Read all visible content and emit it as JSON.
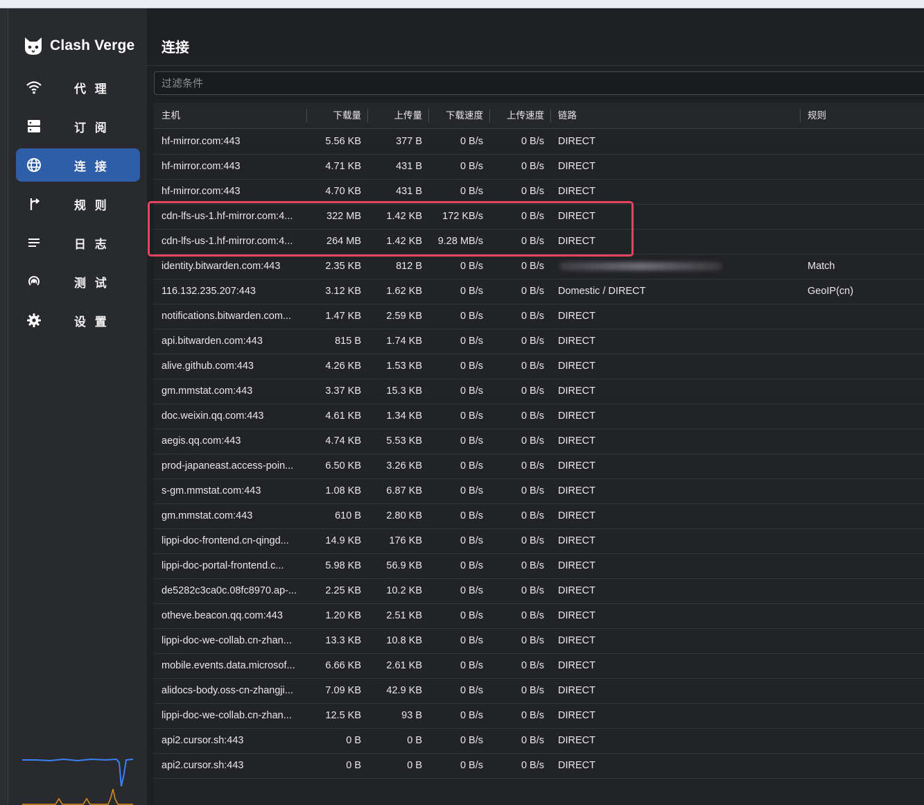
{
  "app": {
    "name": "Clash Verge"
  },
  "sidebar": {
    "items": [
      {
        "label": "代 理",
        "icon": "wifi-icon",
        "active": false
      },
      {
        "label": "订 阅",
        "icon": "server-icon",
        "active": false
      },
      {
        "label": "连 接",
        "icon": "globe-icon",
        "active": true
      },
      {
        "label": "规 则",
        "icon": "fork-icon",
        "active": false
      },
      {
        "label": "日 志",
        "icon": "list-icon",
        "active": false
      },
      {
        "label": "测 试",
        "icon": "radar-icon",
        "active": false
      },
      {
        "label": "设 置",
        "icon": "gear-icon",
        "active": false
      }
    ]
  },
  "page": {
    "title": "连接"
  },
  "filter": {
    "placeholder": "过滤条件",
    "value": ""
  },
  "table": {
    "headers": {
      "host": "主机",
      "download": "下载量",
      "upload": "上传量",
      "dl_speed": "下载速度",
      "ul_speed": "上传速度",
      "chain": "链路",
      "rule": "规则"
    },
    "rows": [
      {
        "host": "hf-mirror.com:443",
        "download": "5.56 KB",
        "upload": "377 B",
        "dl_speed": "0 B/s",
        "ul_speed": "0 B/s",
        "chain": "DIRECT",
        "rule": ""
      },
      {
        "host": "hf-mirror.com:443",
        "download": "4.71 KB",
        "upload": "431 B",
        "dl_speed": "0 B/s",
        "ul_speed": "0 B/s",
        "chain": "DIRECT",
        "rule": ""
      },
      {
        "host": "hf-mirror.com:443",
        "download": "4.70 KB",
        "upload": "431 B",
        "dl_speed": "0 B/s",
        "ul_speed": "0 B/s",
        "chain": "DIRECT",
        "rule": ""
      },
      {
        "host": "cdn-lfs-us-1.hf-mirror.com:4...",
        "download": "322 MB",
        "upload": "1.42 KB",
        "dl_speed": "172 KB/s",
        "ul_speed": "0 B/s",
        "chain": "DIRECT",
        "rule": ""
      },
      {
        "host": "cdn-lfs-us-1.hf-mirror.com:4...",
        "download": "264 MB",
        "upload": "1.42 KB",
        "dl_speed": "9.28 MB/s",
        "ul_speed": "0 B/s",
        "chain": "DIRECT",
        "rule": ""
      },
      {
        "host": "identity.bitwarden.com:443",
        "download": "2.35 KB",
        "upload": "812 B",
        "dl_speed": "0 B/s",
        "ul_speed": "0 B/s",
        "chain": "",
        "rule": "Match",
        "chain_redacted": true
      },
      {
        "host": "116.132.235.207:443",
        "download": "3.12 KB",
        "upload": "1.62 KB",
        "dl_speed": "0 B/s",
        "ul_speed": "0 B/s",
        "chain": "Domestic / DIRECT",
        "rule": "GeoIP(cn)"
      },
      {
        "host": "notifications.bitwarden.com...",
        "download": "1.47 KB",
        "upload": "2.59 KB",
        "dl_speed": "0 B/s",
        "ul_speed": "0 B/s",
        "chain": "DIRECT",
        "rule": ""
      },
      {
        "host": "api.bitwarden.com:443",
        "download": "815 B",
        "upload": "1.74 KB",
        "dl_speed": "0 B/s",
        "ul_speed": "0 B/s",
        "chain": "DIRECT",
        "rule": ""
      },
      {
        "host": "alive.github.com:443",
        "download": "4.26 KB",
        "upload": "1.53 KB",
        "dl_speed": "0 B/s",
        "ul_speed": "0 B/s",
        "chain": "DIRECT",
        "rule": ""
      },
      {
        "host": "gm.mmstat.com:443",
        "download": "3.37 KB",
        "upload": "15.3 KB",
        "dl_speed": "0 B/s",
        "ul_speed": "0 B/s",
        "chain": "DIRECT",
        "rule": ""
      },
      {
        "host": "doc.weixin.qq.com:443",
        "download": "4.61 KB",
        "upload": "1.34 KB",
        "dl_speed": "0 B/s",
        "ul_speed": "0 B/s",
        "chain": "DIRECT",
        "rule": ""
      },
      {
        "host": "aegis.qq.com:443",
        "download": "4.74 KB",
        "upload": "5.53 KB",
        "dl_speed": "0 B/s",
        "ul_speed": "0 B/s",
        "chain": "DIRECT",
        "rule": ""
      },
      {
        "host": "prod-japaneast.access-poin...",
        "download": "6.50 KB",
        "upload": "3.26 KB",
        "dl_speed": "0 B/s",
        "ul_speed": "0 B/s",
        "chain": "DIRECT",
        "rule": ""
      },
      {
        "host": "s-gm.mmstat.com:443",
        "download": "1.08 KB",
        "upload": "6.87 KB",
        "dl_speed": "0 B/s",
        "ul_speed": "0 B/s",
        "chain": "DIRECT",
        "rule": ""
      },
      {
        "host": "gm.mmstat.com:443",
        "download": "610 B",
        "upload": "2.80 KB",
        "dl_speed": "0 B/s",
        "ul_speed": "0 B/s",
        "chain": "DIRECT",
        "rule": ""
      },
      {
        "host": "lippi-doc-frontend.cn-qingd...",
        "download": "14.9 KB",
        "upload": "176 KB",
        "dl_speed": "0 B/s",
        "ul_speed": "0 B/s",
        "chain": "DIRECT",
        "rule": ""
      },
      {
        "host": "lippi-doc-portal-frontend.c...",
        "download": "5.98 KB",
        "upload": "56.9 KB",
        "dl_speed": "0 B/s",
        "ul_speed": "0 B/s",
        "chain": "DIRECT",
        "rule": ""
      },
      {
        "host": "de5282c3ca0c.08fc8970.ap-...",
        "download": "2.25 KB",
        "upload": "10.2 KB",
        "dl_speed": "0 B/s",
        "ul_speed": "0 B/s",
        "chain": "DIRECT",
        "rule": ""
      },
      {
        "host": "otheve.beacon.qq.com:443",
        "download": "1.20 KB",
        "upload": "2.51 KB",
        "dl_speed": "0 B/s",
        "ul_speed": "0 B/s",
        "chain": "DIRECT",
        "rule": ""
      },
      {
        "host": "lippi-doc-we-collab.cn-zhan...",
        "download": "13.3 KB",
        "upload": "10.8 KB",
        "dl_speed": "0 B/s",
        "ul_speed": "0 B/s",
        "chain": "DIRECT",
        "rule": ""
      },
      {
        "host": "mobile.events.data.microsof...",
        "download": "6.66 KB",
        "upload": "2.61 KB",
        "dl_speed": "0 B/s",
        "ul_speed": "0 B/s",
        "chain": "DIRECT",
        "rule": ""
      },
      {
        "host": "alidocs-body.oss-cn-zhangji...",
        "download": "7.09 KB",
        "upload": "42.9 KB",
        "dl_speed": "0 B/s",
        "ul_speed": "0 B/s",
        "chain": "DIRECT",
        "rule": ""
      },
      {
        "host": "lippi-doc-we-collab.cn-zhan...",
        "download": "12.5 KB",
        "upload": "93 B",
        "dl_speed": "0 B/s",
        "ul_speed": "0 B/s",
        "chain": "DIRECT",
        "rule": ""
      },
      {
        "host": "api2.cursor.sh:443",
        "download": "0 B",
        "upload": "0 B",
        "dl_speed": "0 B/s",
        "ul_speed": "0 B/s",
        "chain": "DIRECT",
        "rule": ""
      },
      {
        "host": "api2.cursor.sh:443",
        "download": "0 B",
        "upload": "0 B",
        "dl_speed": "0 B/s",
        "ul_speed": "0 B/s",
        "chain": "DIRECT",
        "rule": ""
      }
    ]
  },
  "traffic_graph": {
    "upload_color": "#3b82f6",
    "download_color": "#d98c1f"
  },
  "colors": {
    "accent": "#2f5ea8",
    "highlight_box": "#e5445f",
    "background": "#1f2024"
  }
}
